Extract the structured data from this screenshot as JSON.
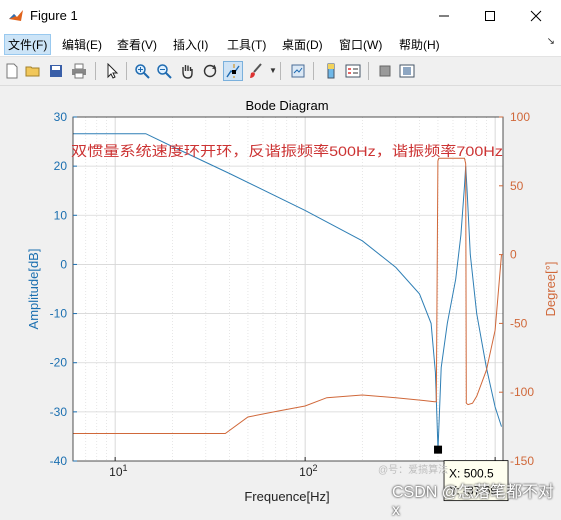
{
  "window": {
    "title": "Figure 1"
  },
  "menu": [
    {
      "label": "文件(F)",
      "active": true
    },
    {
      "label": "编辑(E)"
    },
    {
      "label": "查看(V)"
    },
    {
      "label": "插入(I)"
    },
    {
      "label": "工具(T)"
    },
    {
      "label": "桌面(D)"
    },
    {
      "label": "窗口(W)"
    },
    {
      "label": "帮助(H)"
    }
  ],
  "toolbar": {
    "buttons": [
      "new-figure-icon",
      "open-file-icon",
      "save-icon",
      "print-icon",
      "edit-plot-arrow-icon",
      "zoom-in-icon",
      "zoom-out-icon",
      "pan-hand-icon",
      "rotate-3d-icon",
      "data-cursor-icon",
      "brush-icon",
      "link-plot-icon",
      "insert-colorbar-icon",
      "insert-legend-icon",
      "hide-plot-tools-icon",
      "show-plot-tools-icon"
    ],
    "pressed": "data-cursor-icon"
  },
  "chart_data": {
    "type": "line",
    "title": "Bode Diagram",
    "annotation": "双惯量系统速度环开环，反谐振频率500Hz，谐振频率700Hz",
    "xlabel": "Frequence[Hz]",
    "xscale": "log",
    "xlim": [
      6,
      1100
    ],
    "x_ticks": [
      10,
      100,
      1000
    ],
    "ylabel_left": "Amplitude[dB]",
    "ylim_left": [
      -40,
      30
    ],
    "y_ticks_left": [
      30,
      20,
      10,
      0,
      -10,
      -20,
      -30,
      -40
    ],
    "ylabel_right": "Degree[°]",
    "ylim_right": [
      -150,
      100
    ],
    "y_ticks_right": [
      100,
      50,
      0,
      -50,
      -100,
      -150
    ],
    "grid": true,
    "colors": {
      "amplitude": "#2f7fb5",
      "phase": "#d0683a",
      "axis_left": "#1b6fb0",
      "axis_right": "#d0683a",
      "annotation": "#cc3333"
    },
    "series": [
      {
        "name": "Amplitude[dB]",
        "axis": "left",
        "x": [
          6,
          10,
          14.5,
          20,
          40,
          100,
          200,
          300,
          400,
          460,
          485,
          500.5,
          520,
          560,
          620,
          660,
          690,
          700,
          712,
          740,
          800,
          900,
          1000,
          1080
        ],
        "y": [
          26.6,
          26.6,
          26.6,
          24,
          18.5,
          11,
          4.8,
          -0.6,
          -6,
          -12,
          -22,
          -37.69,
          -21,
          -12,
          -3,
          6,
          16,
          20,
          15,
          2,
          -10,
          -21,
          -29,
          -33
        ]
      },
      {
        "name": "Degree[°]",
        "axis": "right",
        "x": [
          6,
          20,
          38,
          50,
          70,
          100,
          130,
          200,
          300,
          420,
          480,
          490,
          495,
          500,
          505,
          690,
          700,
          705,
          720,
          760,
          800,
          900,
          1000,
          1080
        ],
        "y": [
          -130,
          -130,
          -130,
          -118,
          -114,
          -110,
          -104,
          -102,
          -104,
          -106,
          -107,
          -107,
          -20,
          68,
          70,
          70,
          66,
          -108,
          -109,
          -108,
          -103,
          -84,
          -55,
          0
        ]
      }
    ],
    "datatip": {
      "x_label": "X: 500.5",
      "y_label": "Y: -37.69",
      "x": 500.5,
      "y": -37.69
    }
  },
  "watermark": {
    "faint": "@号：爱搞算法",
    "main": "CSDN @怎落笔都不对x"
  }
}
